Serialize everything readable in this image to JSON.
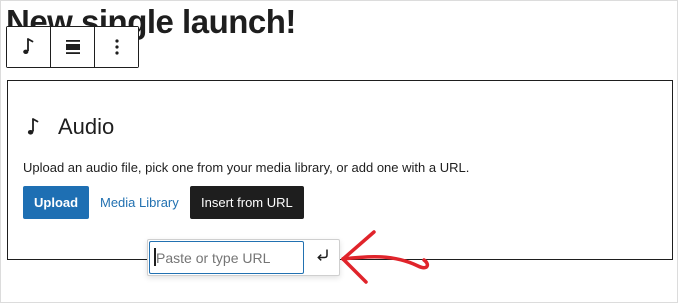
{
  "post": {
    "title": "New single launch!"
  },
  "toolbar": {
    "icons": [
      "music-note-icon",
      "align-icon",
      "more-options-icon"
    ]
  },
  "audio_block": {
    "label": "Audio",
    "icon": "music-note-icon",
    "instructions": "Upload an audio file, pick one from your media library, or add one with a URL.",
    "buttons": {
      "upload": "Upload",
      "media_library": "Media Library",
      "insert_from_url": "Insert from URL"
    }
  },
  "url_popover": {
    "placeholder": "Paste or type URL",
    "value": "",
    "submit_icon": "return-icon"
  },
  "annotation": {
    "icon": "red-arrow-icon",
    "color": "#e0242b"
  },
  "colors": {
    "primary": "#1e6fb3",
    "link": "#2271b1",
    "dark": "#1e1e1e",
    "arrow": "#e0242b"
  }
}
